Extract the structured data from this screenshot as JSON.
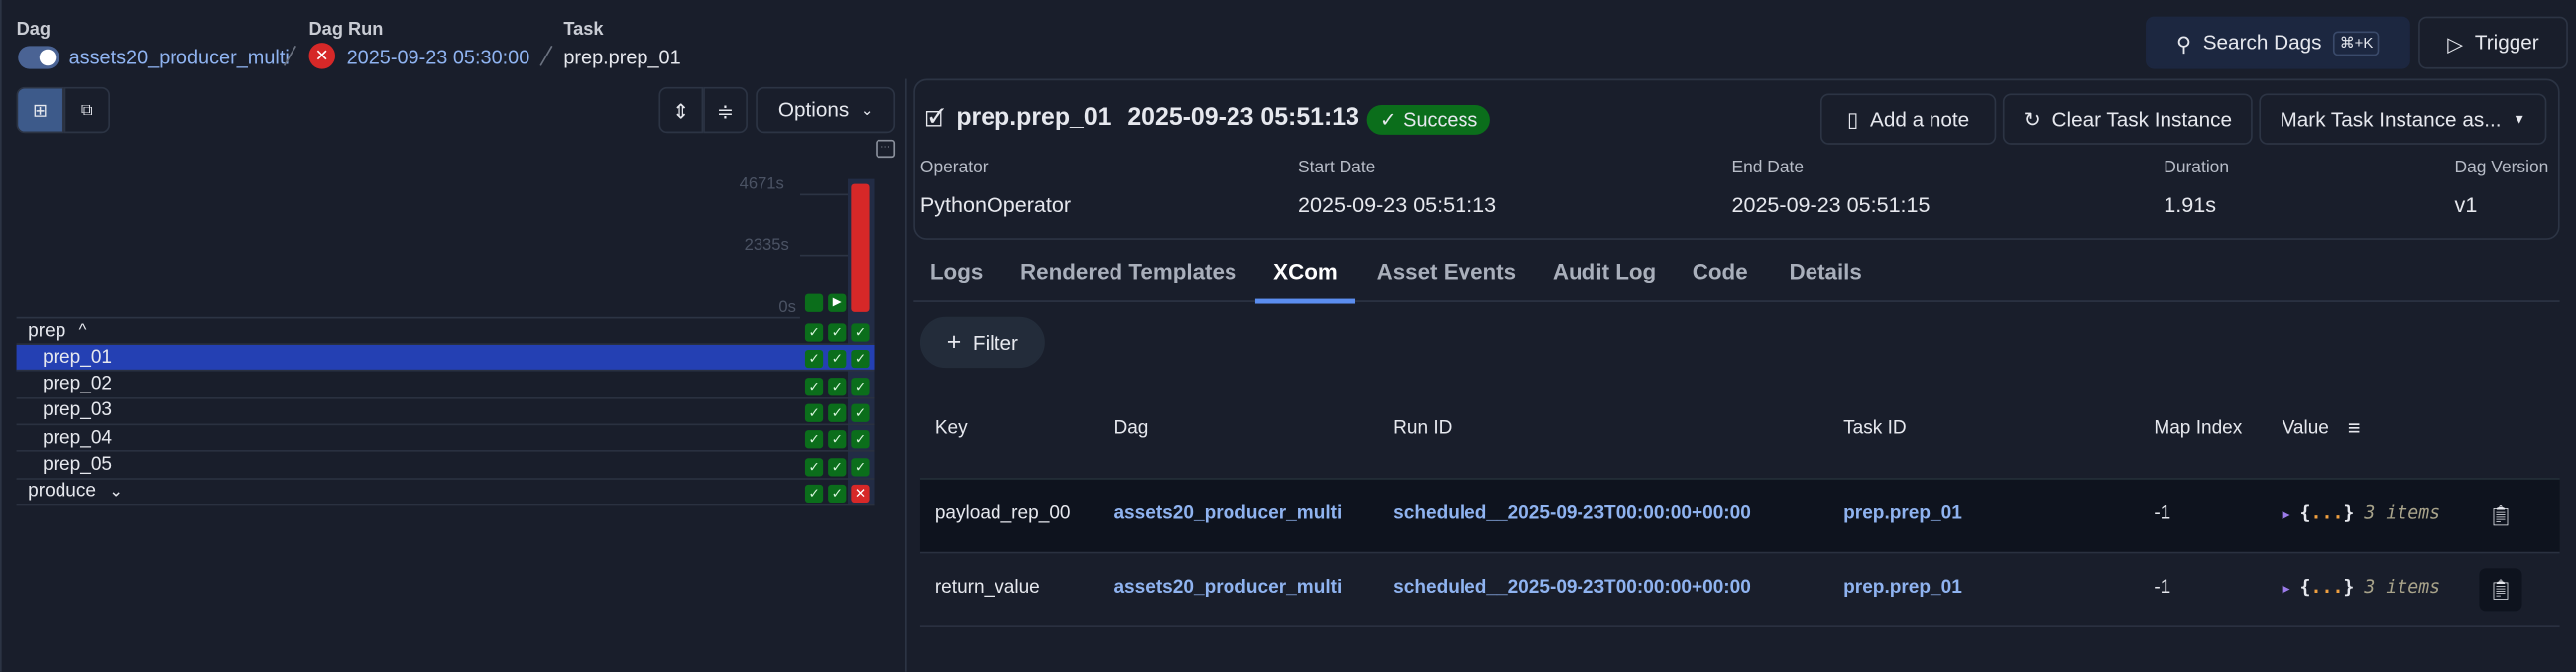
{
  "breadcrumb": {
    "dag": {
      "label": "Dag",
      "value": "assets20_producer_multi",
      "paused": false
    },
    "dag_run": {
      "label": "Dag Run",
      "value": "2025-09-23 05:30:00",
      "state": "failed"
    },
    "task": {
      "label": "Task",
      "value": "prep.prep_01"
    }
  },
  "header": {
    "search_label": "Search Dags",
    "search_shortcut": "⌘+K",
    "trigger_label": "Trigger"
  },
  "grid": {
    "options_label": "Options",
    "duration_ticks": [
      "4671s",
      "2335s",
      "0s"
    ],
    "run_states": [
      "success",
      "running",
      "failed"
    ],
    "run_durations_fraction": [
      0.0,
      0.0,
      1.0
    ],
    "rows": [
      {
        "name": "prep",
        "group": true,
        "expanded": true,
        "states": [
          "success",
          "success",
          "success"
        ]
      },
      {
        "name": "prep_01",
        "selected": true,
        "states": [
          "success",
          "success",
          "success"
        ]
      },
      {
        "name": "prep_02",
        "states": [
          "success",
          "success",
          "success"
        ]
      },
      {
        "name": "prep_03",
        "states": [
          "success",
          "success",
          "success"
        ]
      },
      {
        "name": "prep_04",
        "states": [
          "success",
          "success",
          "success"
        ]
      },
      {
        "name": "prep_05",
        "states": [
          "success",
          "success",
          "success"
        ]
      },
      {
        "name": "produce",
        "group": true,
        "expanded": false,
        "states": [
          "success",
          "success",
          "failed"
        ]
      }
    ]
  },
  "task_instance": {
    "title": "prep.prep_01",
    "date": "2025-09-23 05:51:13",
    "state": "Success",
    "add_note": "Add a note",
    "clear": "Clear Task Instance",
    "mark": "Mark Task Instance as...",
    "meta": [
      {
        "label": "Operator",
        "value": "PythonOperator"
      },
      {
        "label": "Start Date",
        "value": "2025-09-23 05:51:13"
      },
      {
        "label": "End Date",
        "value": "2025-09-23 05:51:15"
      },
      {
        "label": "Duration",
        "value": "1.91s"
      },
      {
        "label": "Dag Version",
        "value": "v1"
      }
    ]
  },
  "tabs": [
    "Logs",
    "Rendered Templates",
    "XCom",
    "Asset Events",
    "Audit Log",
    "Code",
    "Details"
  ],
  "active_tab": "XCom",
  "xcom": {
    "filter_label": "Filter",
    "columns": [
      "Key",
      "Dag",
      "Run ID",
      "Task ID",
      "Map Index",
      "Value"
    ],
    "rows": [
      {
        "key": "payload_rep_00",
        "dag": "assets20_producer_multi",
        "run_id": "scheduled__2025-09-23T00:00:00+00:00",
        "task_id": "prep.prep_01",
        "map_index": "-1",
        "value_open": "{",
        "value_dots": "...",
        "value_close": "}",
        "value_count": "3 items"
      },
      {
        "key": "return_value",
        "dag": "assets20_producer_multi",
        "run_id": "scheduled__2025-09-23T00:00:00+00:00",
        "task_id": "prep.prep_01",
        "map_index": "-1",
        "value_open": "{",
        "value_dots": "...",
        "value_close": "}",
        "value_count": "3 items"
      }
    ]
  },
  "colors": {
    "success": "#0b6e1b",
    "failed": "#d62828",
    "selected_row": "#2440b3",
    "link": "#8fb3f0",
    "accent": "#5b8def"
  }
}
